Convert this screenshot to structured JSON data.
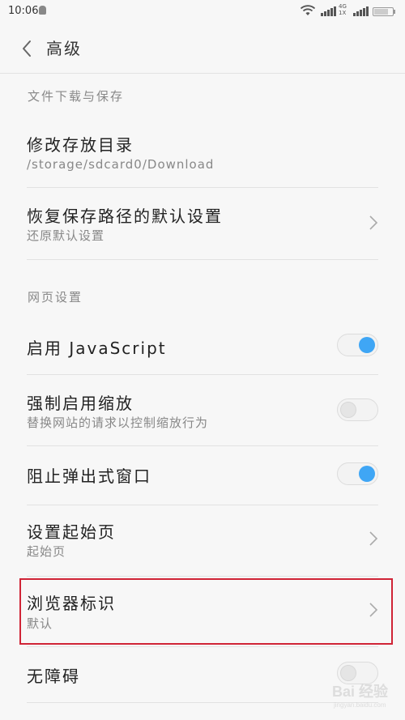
{
  "status_bar": {
    "time": "10:06",
    "network": "4G\n1X"
  },
  "header": {
    "title": "高级"
  },
  "sections": {
    "download": "文件下载与保存",
    "web": "网页设置"
  },
  "rows": {
    "storage_dir": {
      "title": "修改存放目录",
      "subtitle": "/storage/sdcard0/Download"
    },
    "restore_path": {
      "title": "恢复保存路径的默认设置",
      "subtitle": "还原默认设置"
    },
    "javascript": {
      "title": "启用 JavaScript",
      "enabled": true
    },
    "force_zoom": {
      "title": "强制启用缩放",
      "subtitle": "替换网站的请求以控制缩放行为",
      "enabled": false
    },
    "block_popups": {
      "title": "阻止弹出式窗口",
      "enabled": true
    },
    "home_page": {
      "title": "设置起始页",
      "subtitle": "起始页"
    },
    "user_agent": {
      "title": "浏览器标识",
      "subtitle": "默认"
    },
    "accessibility": {
      "title": "无障碍",
      "enabled": false
    }
  },
  "watermark": {
    "text": "Bai 经验",
    "sub": "jingyan.baidu.com"
  },
  "colors": {
    "toggle_on": "#3fa6f5",
    "highlight": "#d02436"
  }
}
